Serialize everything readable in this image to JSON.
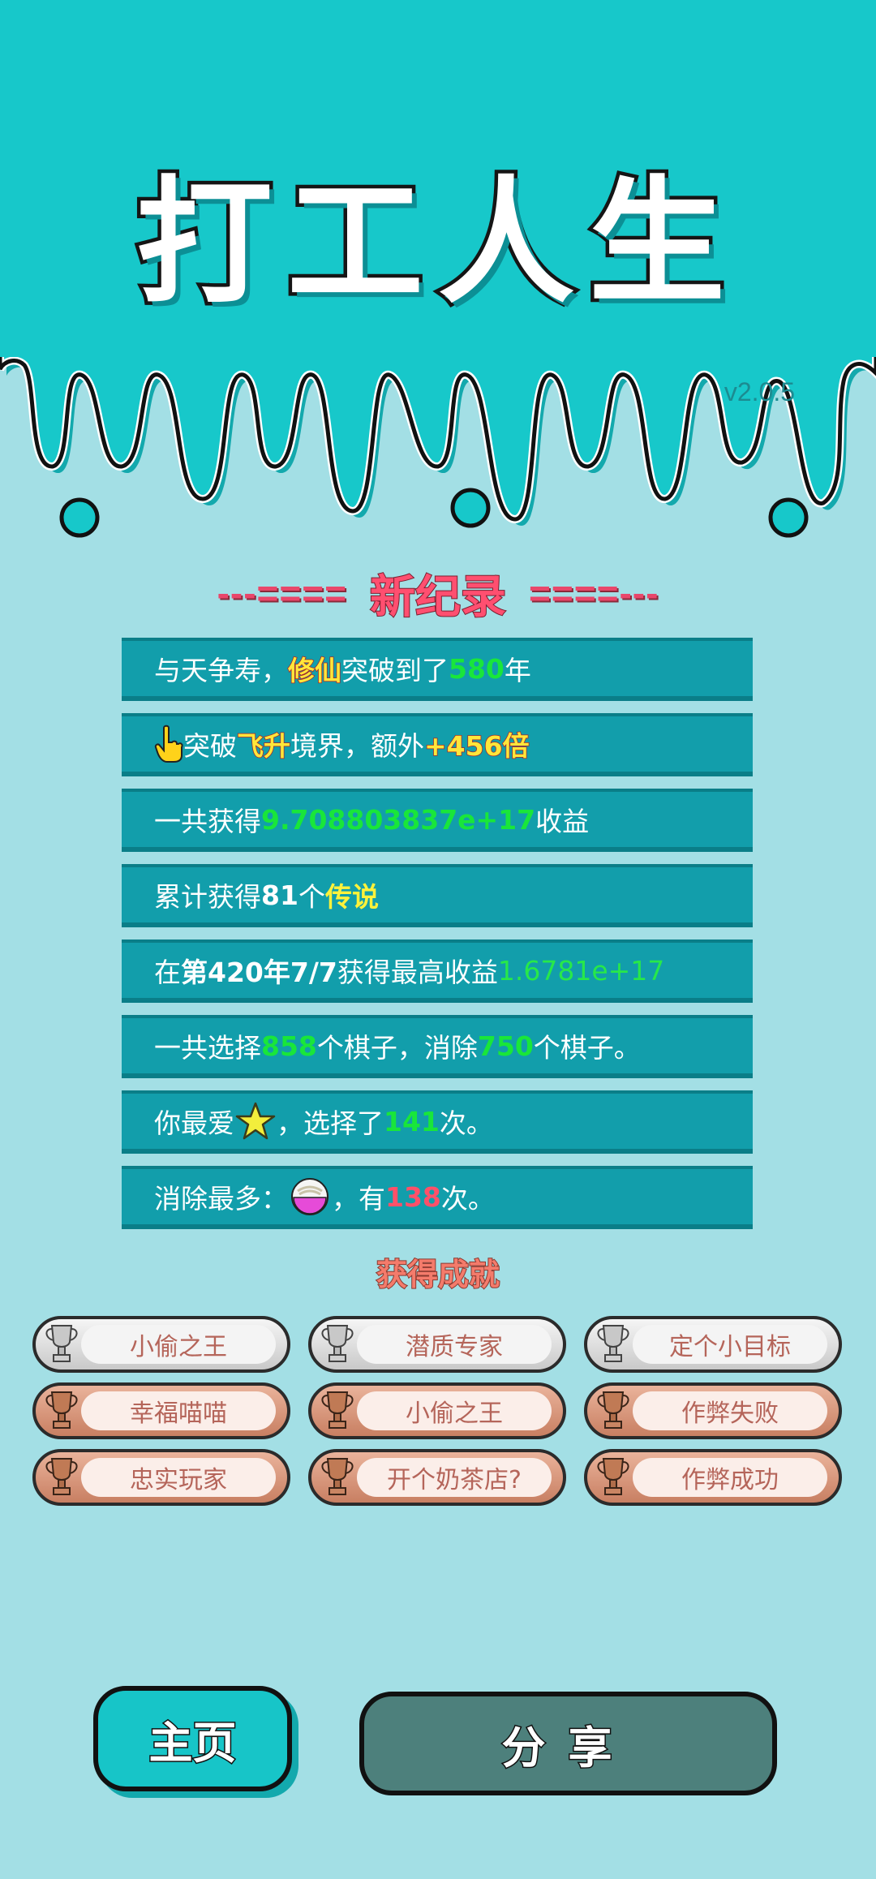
{
  "app": {
    "title": "打工人生",
    "version": "v2.0.5"
  },
  "record": {
    "left_deco": "---====",
    "title": "新纪录",
    "right_deco": "====---"
  },
  "stats": {
    "s1": {
      "a": "与天争寿，",
      "hl": "修仙",
      "b": "突破到了",
      "num": "580",
      "c": "年"
    },
    "s2": {
      "a": "突破",
      "hl": "飞升",
      "b": "境界，额外",
      "hl2": "+456倍"
    },
    "s3": {
      "a": "一共获得",
      "num": "9.708803837e+17",
      "b": "收益"
    },
    "s4": {
      "a": "累计获得",
      "num": "81",
      "b": "个",
      "hl": "传说"
    },
    "s5": {
      "a": "在 ",
      "w": "第420年7/7",
      "b": " 获得最高收益",
      "num": "1.6781e+17"
    },
    "s6": {
      "a": "一共选择",
      "num": "858",
      "b": "个棋子，消除",
      "num2": "750",
      "c": "个棋子。"
    },
    "s7": {
      "a": "你最爱",
      "b": "，选择了",
      "num": "141",
      "c": "次。"
    },
    "s8": {
      "a": "消除最多：",
      "b": "，有",
      "num": "138",
      "c": "次。"
    }
  },
  "achievements_title": "获得成就",
  "achievements": [
    {
      "label": "小偷之王",
      "tier": "silver"
    },
    {
      "label": "潜质专家",
      "tier": "silver"
    },
    {
      "label": "定个小目标",
      "tier": "silver"
    },
    {
      "label": "幸福喵喵",
      "tier": "bronze"
    },
    {
      "label": "小偷之王",
      "tier": "bronze"
    },
    {
      "label": "作弊失败",
      "tier": "bronze"
    },
    {
      "label": "忠实玩家",
      "tier": "bronze"
    },
    {
      "label": "开个奶茶店?",
      "tier": "bronze"
    },
    {
      "label": "作弊成功",
      "tier": "bronze"
    }
  ],
  "buttons": {
    "home": "主页",
    "share": "分享"
  },
  "colors": {
    "teal": "#17c5c8",
    "background": "#a3dfe5",
    "stat_bar": "#129eab",
    "accent_green": "#19e63a",
    "accent_red": "#ff5069"
  }
}
